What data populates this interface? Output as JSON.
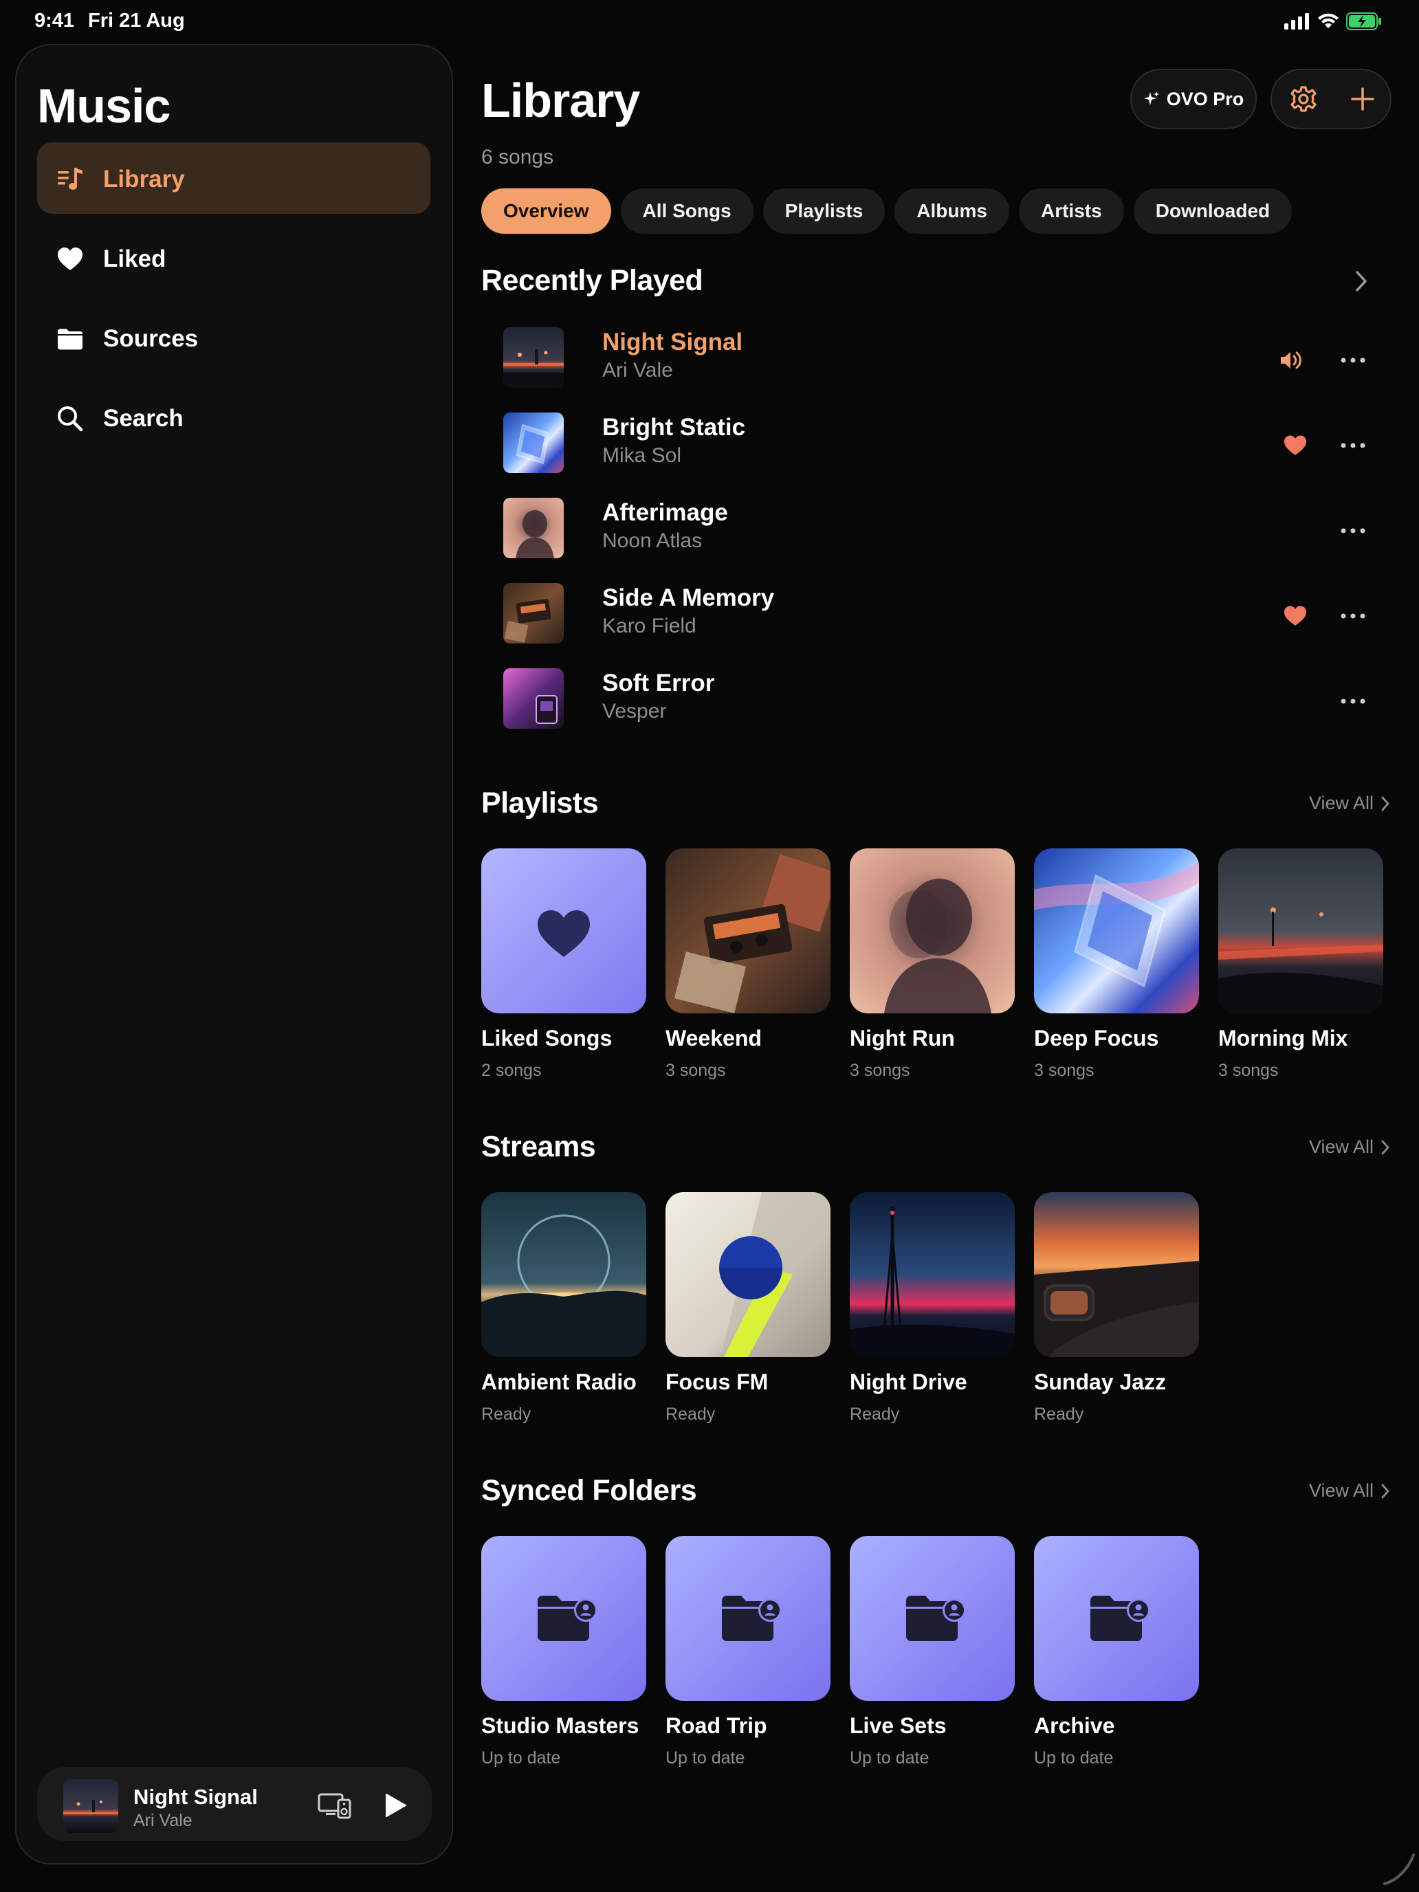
{
  "status": {
    "time": "9:41",
    "date": "Fri 21 Aug"
  },
  "sidebar": {
    "title": "Music",
    "items": [
      {
        "label": "Library",
        "icon": "library-music-icon",
        "active": true
      },
      {
        "label": "Liked",
        "icon": "heart-icon"
      },
      {
        "label": "Sources",
        "icon": "folder-icon"
      },
      {
        "label": "Search",
        "icon": "search-icon"
      }
    ]
  },
  "mini_player": {
    "title": "Night Signal",
    "artist": "Ari Vale"
  },
  "header": {
    "title": "Library",
    "subtitle": "6 songs",
    "pro_label": "OVO Pro"
  },
  "tabs": [
    {
      "label": "Overview",
      "active": true
    },
    {
      "label": "All Songs"
    },
    {
      "label": "Playlists"
    },
    {
      "label": "Albums"
    },
    {
      "label": "Artists"
    },
    {
      "label": "Downloaded"
    }
  ],
  "recently_played": {
    "title": "Recently Played",
    "items": [
      {
        "title": "Night Signal",
        "artist": "Ari Vale",
        "status": "speaker-icon"
      },
      {
        "title": "Bright Static",
        "artist": "Mika Sol",
        "status": "heart-icon"
      },
      {
        "title": "Afterimage",
        "artist": "Noon Atlas",
        "status": ""
      },
      {
        "title": "Side A Memory",
        "artist": "Karo Field",
        "status": "heart-icon"
      },
      {
        "title": "Soft Error",
        "artist": "Vesper",
        "status": ""
      }
    ]
  },
  "playlists": {
    "title": "Playlists",
    "view_all": "View All",
    "items": [
      {
        "name": "Liked Songs",
        "count": "2 songs"
      },
      {
        "name": "Weekend",
        "count": "3 songs"
      },
      {
        "name": "Night Run",
        "count": "3 songs"
      },
      {
        "name": "Deep Focus",
        "count": "3 songs"
      },
      {
        "name": "Morning Mix",
        "count": "3 songs"
      }
    ]
  },
  "streams": {
    "title": "Streams",
    "view_all": "View All",
    "items": [
      {
        "name": "Ambient Radio",
        "status": "Ready"
      },
      {
        "name": "Focus FM",
        "status": "Ready"
      },
      {
        "name": "Night Drive",
        "status": "Ready"
      },
      {
        "name": "Sunday Jazz",
        "status": "Ready"
      }
    ]
  },
  "synced_folders": {
    "title": "Synced Folders",
    "view_all": "View All",
    "items": [
      {
        "name": "Studio Masters",
        "status": "Up to date"
      },
      {
        "name": "Road Trip",
        "status": "Up to date"
      },
      {
        "name": "Live Sets",
        "status": "Up to date"
      },
      {
        "name": "Archive",
        "status": "Up to date"
      }
    ]
  },
  "colors": {
    "accent": "#f4a06a",
    "heart": "#f27a63",
    "folder_tile": "#8a86f4",
    "background": "#070707"
  }
}
